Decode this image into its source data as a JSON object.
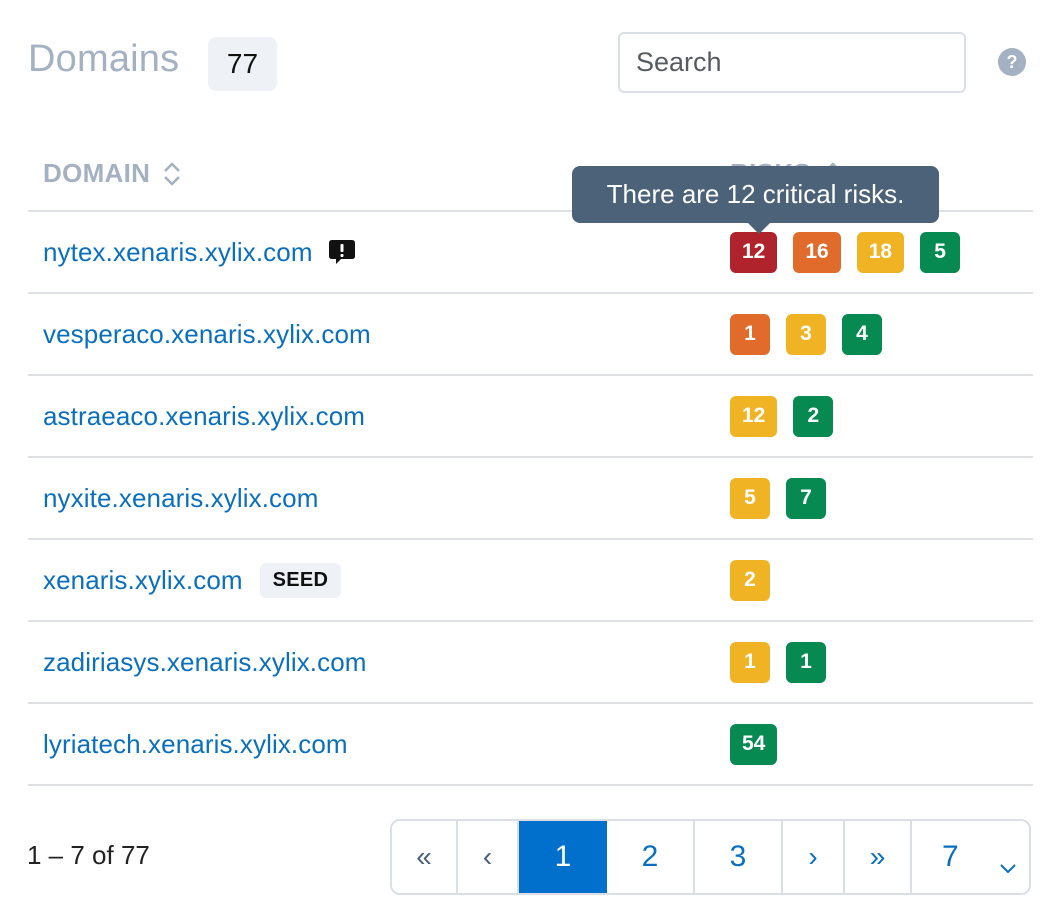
{
  "header": {
    "title": "Domains",
    "count": "77",
    "search_placeholder": "Search",
    "help_icon": "?"
  },
  "colors": {
    "critical": "#b0232c",
    "high": "#e06b2a",
    "medium": "#f0b323",
    "low": "#078a51",
    "link": "#0b6fbf",
    "active_page": "#0070cc",
    "tooltip_bg": "#4b6279"
  },
  "table": {
    "columns": [
      {
        "label": "DOMAIN",
        "sort": "unsorted"
      },
      {
        "label": "RISKS",
        "sort": "ascending"
      }
    ],
    "rows": [
      {
        "domain": "nytex.xenaris.xylix.com",
        "alert": true,
        "seed": null,
        "risks": [
          {
            "level": "critical",
            "count": "12"
          },
          {
            "level": "high",
            "count": "16"
          },
          {
            "level": "medium",
            "count": "18"
          },
          {
            "level": "low",
            "count": "5"
          }
        ]
      },
      {
        "domain": "vesperaco.xenaris.xylix.com",
        "alert": false,
        "seed": null,
        "risks": [
          {
            "level": "high",
            "count": "1"
          },
          {
            "level": "medium",
            "count": "3"
          },
          {
            "level": "low",
            "count": "4"
          }
        ]
      },
      {
        "domain": "astraeaco.xenaris.xylix.com",
        "alert": false,
        "seed": null,
        "risks": [
          {
            "level": "medium",
            "count": "12"
          },
          {
            "level": "low",
            "count": "2"
          }
        ]
      },
      {
        "domain": "nyxite.xenaris.xylix.com",
        "alert": false,
        "seed": null,
        "risks": [
          {
            "level": "medium",
            "count": "5"
          },
          {
            "level": "low",
            "count": "7"
          }
        ]
      },
      {
        "domain": "xenaris.xylix.com",
        "alert": false,
        "seed": "SEED",
        "risks": [
          {
            "level": "medium",
            "count": "2"
          }
        ]
      },
      {
        "domain": "zadiriasys.xenaris.xylix.com",
        "alert": false,
        "seed": null,
        "risks": [
          {
            "level": "medium",
            "count": "1"
          },
          {
            "level": "low",
            "count": "1"
          }
        ]
      },
      {
        "domain": "lyriatech.xenaris.xylix.com",
        "alert": false,
        "seed": null,
        "risks": [
          {
            "level": "low",
            "count": "54"
          }
        ]
      }
    ]
  },
  "tooltip": {
    "text": "There are 12 critical risks."
  },
  "footer": {
    "range_text": "1 – 7 of 77",
    "pagination": {
      "first": "«",
      "prev": "‹",
      "pages": [
        "1",
        "2",
        "3"
      ],
      "current": "1",
      "next": "›",
      "last": "»",
      "page_select_value": "7"
    }
  }
}
